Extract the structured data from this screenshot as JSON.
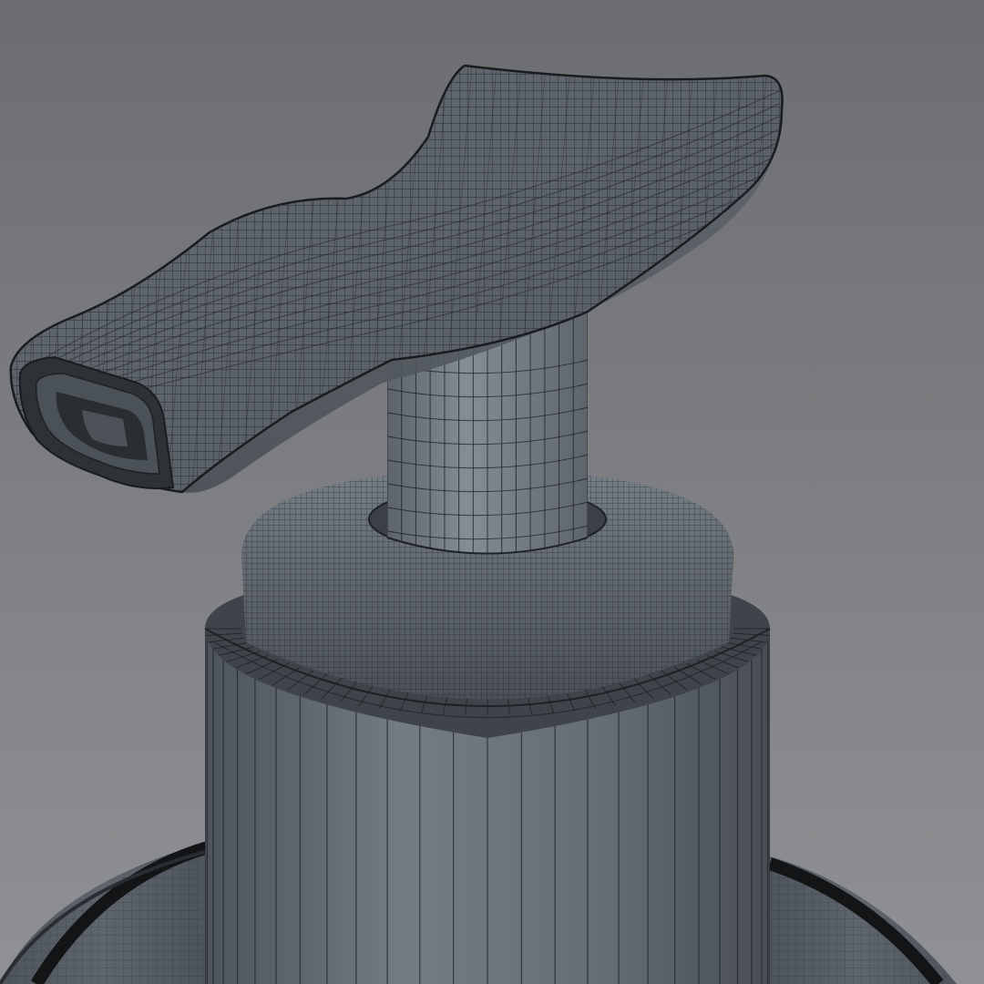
{
  "viewport": {
    "background_top": "#6c6e71",
    "background_bottom": "#909295"
  },
  "model": {
    "subject": "soap-dispenser-pump",
    "shading": "wireframe-on-shaded",
    "colors": {
      "surface_light": "#6f767d",
      "surface_mid": "#5a6168",
      "surface_dark": "#3f454b",
      "wire": "#1e2226",
      "cavity": "#2a2e32",
      "bottle_edge": "#121416"
    }
  }
}
